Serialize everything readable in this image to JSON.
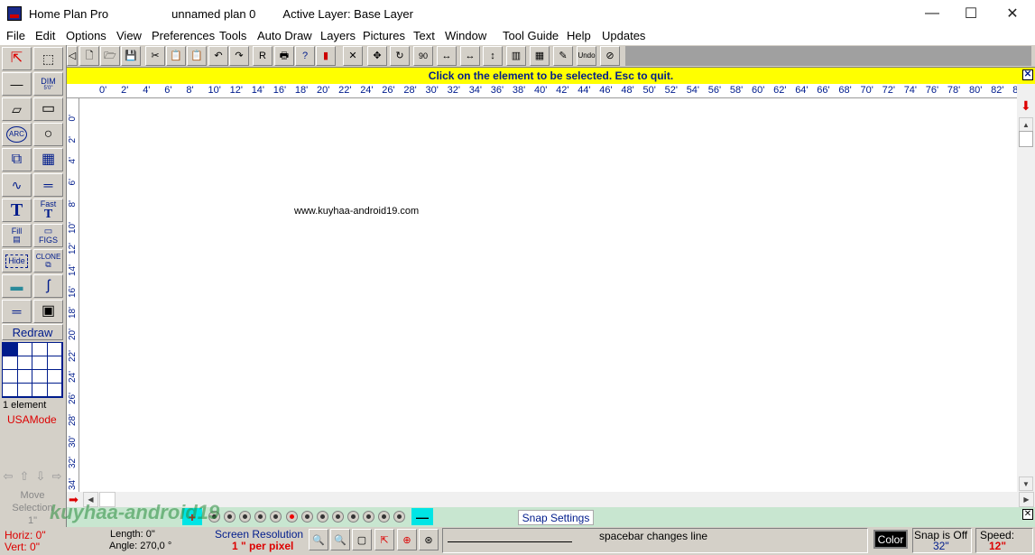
{
  "window": {
    "title": "Home Plan Pro",
    "plan_name": "unnamed plan 0",
    "active_layer": "Active Layer: Base Layer",
    "minimize": "—",
    "maximize": "☐",
    "close": "✕"
  },
  "menu": [
    "File",
    "Edit",
    "Options",
    "View",
    "Preferences",
    "Tools",
    "Auto Draw",
    "Layers",
    "Pictures",
    "Text",
    "Window",
    "Tool Guide",
    "Help",
    "Updates"
  ],
  "toolbar_icons": [
    "◁",
    "🗋",
    "🗁",
    "💾",
    "✂",
    "📋",
    "📋",
    "↶",
    "↷",
    "R",
    "🖶",
    "?",
    "▮",
    "✕",
    "✥",
    "↻",
    "90",
    "↔",
    "↔",
    "↕",
    "▥",
    "▦",
    "✎",
    "Undo",
    "⊘"
  ],
  "left_tools": {
    "dim": "DIM",
    "dim_sub": "5'0\"",
    "arc": "ARC",
    "fast": "Fast",
    "fill": "Fill",
    "figs": "FIGS",
    "hide": "Hide",
    "clone": "CLONE",
    "redraw": "Redraw",
    "element_count": "1 element",
    "mode": "USAMode",
    "move_selection_line1": "Move",
    "move_selection_line2": "Selection",
    "move_step": "1\""
  },
  "message": "Click on the element to be selected.  Esc to quit.",
  "message_close": "✕",
  "hruler_labels": [
    "0'",
    "2'",
    "4'",
    "6'",
    "8'",
    "10'",
    "12'",
    "14'",
    "16'",
    "18'",
    "20'",
    "22'",
    "24'",
    "26'",
    "28'",
    "30'",
    "32'",
    "34'",
    "36'",
    "38'",
    "40'",
    "42'",
    "44'",
    "46'",
    "48'",
    "50'",
    "52'",
    "54'",
    "56'",
    "58'",
    "60'",
    "62'",
    "64'",
    "66'",
    "68'",
    "70'",
    "72'",
    "74'",
    "76'",
    "78'",
    "80'",
    "82'",
    "84'",
    "8"
  ],
  "vruler_labels": [
    "0'",
    "2'",
    "4'",
    "6'",
    "8'",
    "10'",
    "12'",
    "14'",
    "16'",
    "18'",
    "20'",
    "22'",
    "24'",
    "26'",
    "28'",
    "30'",
    "32'",
    "34'"
  ],
  "canvas_text": "www.kuyhaa-android19.com",
  "layer_bar": {
    "add": "+",
    "remove": "—",
    "snap_settings": "Snap Settings"
  },
  "status": {
    "horiz": "Horiz: 0\"",
    "vert": "Vert:  0\"",
    "length": "Length: 0\"",
    "angle": "Angle:  270,0 °",
    "resolution_label": "Screen Resolution",
    "resolution_value": "1 \" per pixel",
    "hint": "spacebar changes line",
    "color": "Color",
    "snap_label": "Snap is Off",
    "snap_value": "32\"",
    "speed_label": "Speed:",
    "speed_value": "12\""
  },
  "brand_overlay": "kuyhaa-android19",
  "colors": {
    "accent_blue": "#001c8c",
    "message_bg": "#ffff00",
    "layer_bar_bg": "#c8e6d0",
    "mode_red": "#dd0000"
  }
}
